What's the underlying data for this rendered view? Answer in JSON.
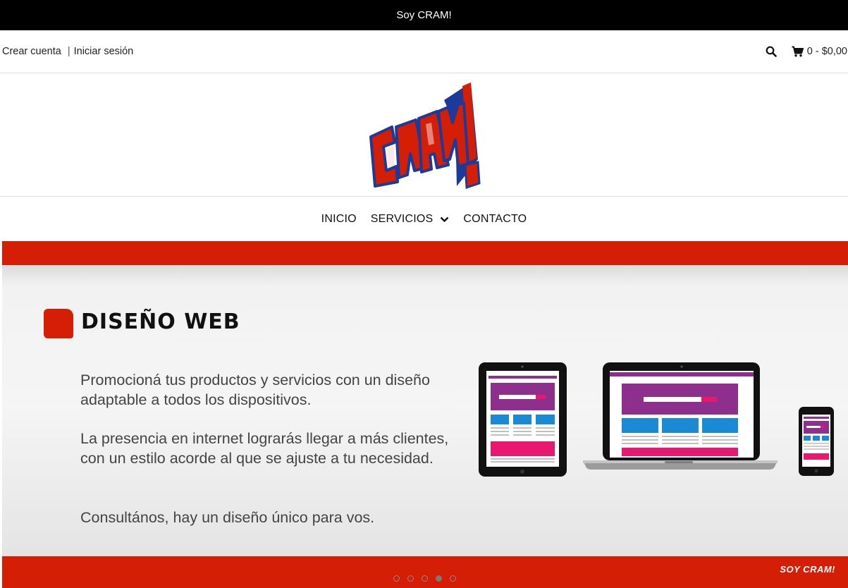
{
  "announcement": "Soy CRAM!",
  "account": {
    "create": "Crear cuenta",
    "separator": "|",
    "login": "Iniciar sesión"
  },
  "cart": {
    "label": "0 - $0,00"
  },
  "nav": {
    "items": [
      "INICIO",
      "SERVICIOS",
      "CONTACTO"
    ]
  },
  "hero": {
    "title": "DISEÑO WEB",
    "paragraphs": [
      "Promocioná tus productos y servicios con un diseño adaptable a todos los dispositivos.",
      "La presencia en internet lograrás llegar a más clientes, con un estilo acorde al que se ajuste a tu necesidad.",
      "Consultános, hay un diseño único para vos."
    ],
    "brand_mark": "SOY CRAM!",
    "slides": {
      "count": 5,
      "active_index": 3
    }
  },
  "colors": {
    "brand_red": "#d41e06",
    "logo_blue": "#1c3a9a",
    "accent_purple": "#8e2f8e",
    "accent_blue": "#1a8ad4",
    "accent_pink": "#e8176f"
  },
  "icons": {
    "search": "search-icon",
    "cart": "cart-icon",
    "dropdown": "chevron-down-icon"
  }
}
